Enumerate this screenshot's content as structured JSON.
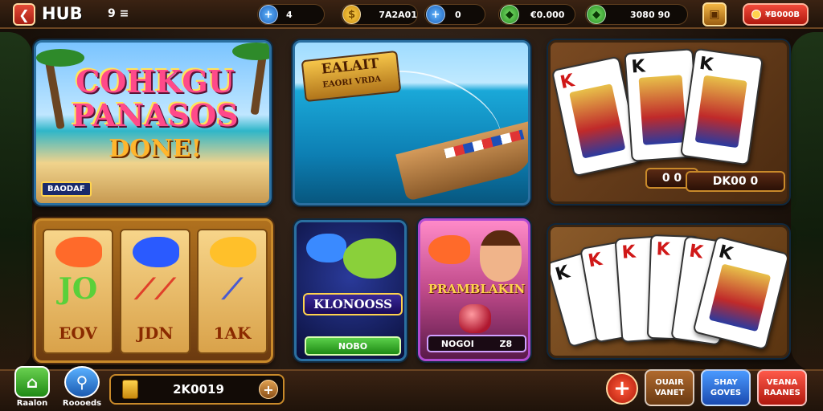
{
  "topbar": {
    "back_icon": "back-arrow-icon",
    "title": "HUB",
    "subtitle": "9 ≡",
    "resources": [
      {
        "icon": "blue-plus-icon",
        "glyph": "+",
        "value": "4"
      },
      {
        "icon": "coin-icon",
        "glyph": "$",
        "value": "7A2A01"
      },
      {
        "icon": "blue-plus-icon",
        "glyph": "+",
        "value": "0"
      },
      {
        "icon": "green-gem-icon",
        "glyph": "◆",
        "value": "€0.000"
      },
      {
        "icon": "green-gem-icon",
        "glyph": "◆",
        "value": "3080 90"
      }
    ],
    "chest_icon": "treasure-chest-icon",
    "shop_label": "¥B000B"
  },
  "tiles": {
    "beach": {
      "title_line1": "COHKGU",
      "title_line2": "PANASOS",
      "title_line3": "DONE!",
      "tag": "BAODAF"
    },
    "fishing": {
      "banner_line1": "EALAIT",
      "banner_line2": "EAORI VRDA"
    },
    "cards_top": {
      "card_rank": "K",
      "badge_left": "0 0",
      "badge_right": "DK00 0"
    },
    "slots": {
      "reels": [
        {
          "big": "JO",
          "bottom": "EOV",
          "fish_color": "#ff6a2a",
          "big_color": "#5ad03a"
        },
        {
          "big": "⟋⟋",
          "bottom": "JDN",
          "fish_color": "#2a5aff",
          "big_color": "#e0402a"
        },
        {
          "big": "⟋",
          "bottom": "1AK",
          "fish_color": "#ffc02a",
          "big_color": "#4a5ad0"
        }
      ]
    },
    "fishgame": {
      "title": "KLONOOSS",
      "button": "NOBO"
    },
    "character": {
      "title": "PRAMBLAKIN",
      "bar_left": "NOGOI",
      "bar_right": "Z8"
    },
    "cards_bottom": {
      "card_rank": "K"
    }
  },
  "bottombar": {
    "home_label": "Raalon",
    "search_label": "Roooeds",
    "balance": "2K0019",
    "actions": [
      {
        "line1": "OUAIR",
        "line2": "VANET",
        "color": "#8a4a1e"
      },
      {
        "line1": "SHAY",
        "line2": "GOVES",
        "color": "#2a6ad0"
      },
      {
        "line1": "VEANA",
        "line2": "RAANES",
        "color": "#e0302a"
      }
    ]
  }
}
